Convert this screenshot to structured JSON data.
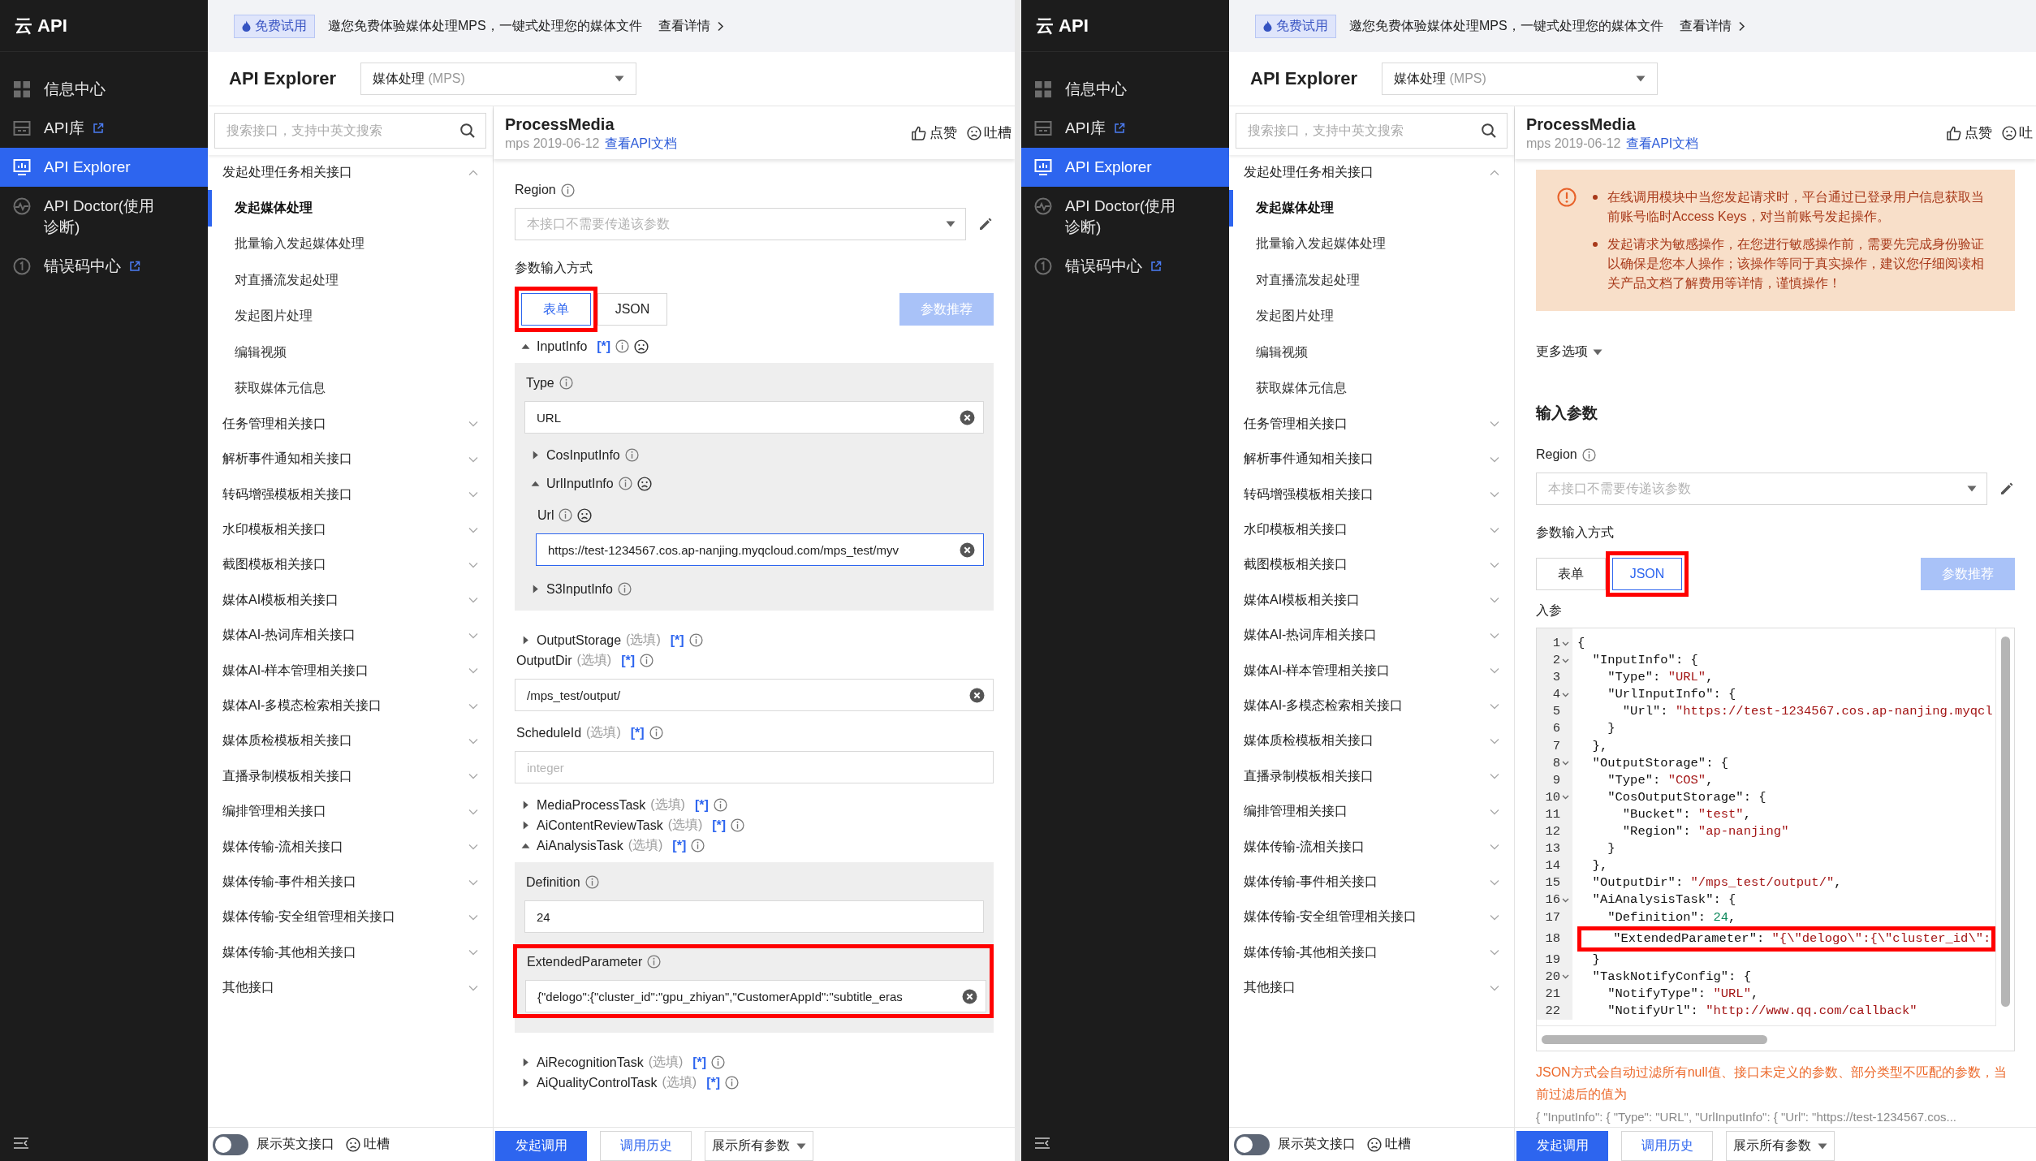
{
  "panes": [
    {
      "nav": {
        "logo": "云 API",
        "items": [
          {
            "label": "信息中心",
            "external": false,
            "selected": false
          },
          {
            "label": "API库",
            "external": true,
            "selected": false
          },
          {
            "label": "API Explorer",
            "external": false,
            "selected": true
          },
          {
            "label": "API Doctor(使用诊断)",
            "external": false,
            "selected": false
          },
          {
            "label": "错误码中心",
            "external": true,
            "selected": false
          }
        ]
      },
      "banner": {
        "tag": "免费试用",
        "text": "邀您免费体验媒体处理MPS，一键式处理您的媒体文件",
        "link": "查看详情"
      },
      "header": {
        "title": "API Explorer",
        "product": "媒体处理",
        "product_code": "(MPS)"
      },
      "search": {
        "placeholder": "搜索接口，支持中英文搜索"
      },
      "api_groups": [
        {
          "label": "发起处理任务相关接口",
          "expanded": true,
          "children": [
            {
              "label": "发起媒体处理",
              "selected": true
            },
            {
              "label": "批量输入发起媒体处理",
              "selected": false
            },
            {
              "label": "对直播流发起处理",
              "selected": false
            },
            {
              "label": "发起图片处理",
              "selected": false
            },
            {
              "label": "编辑视频",
              "selected": false
            },
            {
              "label": "获取媒体元信息",
              "selected": false
            }
          ]
        },
        {
          "label": "任务管理相关接口",
          "expanded": false
        },
        {
          "label": "解析事件通知相关接口",
          "expanded": false
        },
        {
          "label": "转码增强模板相关接口",
          "expanded": false
        },
        {
          "label": "水印模板相关接口",
          "expanded": false
        },
        {
          "label": "截图模板相关接口",
          "expanded": false
        },
        {
          "label": "媒体AI模板相关接口",
          "expanded": false
        },
        {
          "label": "媒体AI-热词库相关接口",
          "expanded": false
        },
        {
          "label": "媒体AI-样本管理相关接口",
          "expanded": false
        },
        {
          "label": "媒体AI-多模态检索相关接口",
          "expanded": false
        },
        {
          "label": "媒体质检模板相关接口",
          "expanded": false
        },
        {
          "label": "直播录制模板相关接口",
          "expanded": false
        },
        {
          "label": "编排管理相关接口",
          "expanded": false
        },
        {
          "label": "媒体传输-流相关接口",
          "expanded": false
        },
        {
          "label": "媒体传输-事件相关接口",
          "expanded": false
        },
        {
          "label": "媒体传输-安全组管理相关接口",
          "expanded": false
        },
        {
          "label": "媒体传输-其他相关接口",
          "expanded": false
        },
        {
          "label": "其他接口",
          "expanded": false
        }
      ],
      "list_footer": {
        "toggle_on": false,
        "toggle_label": "展示英文接口",
        "feedback": "吐槽"
      },
      "api": {
        "name": "ProcessMedia",
        "meta": "mps 2019-06-12",
        "doc_link": "查看API文档",
        "like": "点赞",
        "feedback": "吐槽"
      },
      "blocks": [
        {
          "kind": "select",
          "label": "Region",
          "placeholder": "本接口不需要传递该参数"
        },
        {
          "kind": "mode-switch",
          "label": "参数输入方式",
          "options": [
            {
              "label": "表单",
              "selected": true,
              "highlighted": true
            },
            {
              "label": "JSON",
              "selected": false
            }
          ],
          "recommend": "参数推荐"
        },
        {
          "kind": "params",
          "items": [
            {
              "kind": "group",
              "label": "InputInfo",
              "star": "[*]",
              "info": true,
              "feedback": true,
              "expanded": true,
              "children": [
                {
                  "kind": "field",
                  "label": "Type",
                  "info": true,
                  "value": "URL",
                  "clearable": true,
                  "focused": false
                },
                {
                  "kind": "group",
                  "label": "CosInputInfo",
                  "info": true,
                  "expanded": false
                },
                {
                  "kind": "group",
                  "label": "UrlInputInfo",
                  "info": true,
                  "feedback": true,
                  "expanded": true,
                  "children": [
                    {
                      "kind": "field",
                      "label": "Url",
                      "info": true,
                      "feedback": true,
                      "value": "https://test-1234567.cos.ap-nanjing.myqcloud.com/mps_test/myv",
                      "clearable": true,
                      "focused": true
                    }
                  ]
                },
                {
                  "kind": "group",
                  "label": "S3InputInfo",
                  "info": true,
                  "expanded": false
                }
              ]
            },
            {
              "kind": "group",
              "label": "OutputStorage",
              "optional": "(选填)",
              "star": "[*]",
              "info": true,
              "expanded": false
            },
            {
              "kind": "field",
              "label": "OutputDir",
              "optional": "(选填)",
              "star": "[*]",
              "info": true,
              "value": "/mps_test/output/",
              "clearable": true,
              "focused": false
            },
            {
              "kind": "field",
              "label": "ScheduleId",
              "optional": "(选填)",
              "star": "[*]",
              "info": true,
              "placeholder": "integer",
              "focused": false
            },
            {
              "kind": "group",
              "label": "MediaProcessTask",
              "optional": "(选填)",
              "star": "[*]",
              "info": true,
              "expanded": false
            },
            {
              "kind": "group",
              "label": "AiContentReviewTask",
              "optional": "(选填)",
              "star": "[*]",
              "info": true,
              "expanded": false
            },
            {
              "kind": "group",
              "label": "AiAnalysisTask",
              "optional": "(选填)",
              "star": "[*]",
              "info": true,
              "expanded": true,
              "children": [
                {
                  "kind": "field",
                  "label": "Definition",
                  "info": true,
                  "value": "24",
                  "focused": false
                },
                {
                  "kind": "field",
                  "label": "ExtendedParameter",
                  "info": true,
                  "value": "{\"delogo\":{\"cluster_id\":\"gpu_zhiyan\",\"CustomerAppId\":\"subtitle_eras",
                  "clearable": true,
                  "focused": false,
                  "highlighted": true
                }
              ]
            },
            {
              "kind": "group",
              "label": "AiRecognitionTask",
              "optional": "(选填)",
              "star": "[*]",
              "info": true,
              "expanded": false
            },
            {
              "kind": "group",
              "label": "AiQualityControlTask",
              "optional": "(选填)",
              "star": "[*]",
              "info": true,
              "expanded": false
            }
          ]
        }
      ],
      "actions": {
        "submit": "发起调用",
        "history": "调用历史",
        "show_all": "展示所有参数"
      }
    },
    {
      "nav": {
        "logo": "云 API",
        "items": [
          {
            "label": "信息中心",
            "external": false,
            "selected": false
          },
          {
            "label": "API库",
            "external": true,
            "selected": false
          },
          {
            "label": "API Explorer",
            "external": false,
            "selected": true
          },
          {
            "label": "API Doctor(使用诊断)",
            "external": false,
            "selected": false
          },
          {
            "label": "错误码中心",
            "external": true,
            "selected": false
          }
        ]
      },
      "banner": {
        "tag": "免费试用",
        "text": "邀您免费体验媒体处理MPS，一键式处理您的媒体文件",
        "link": "查看详情"
      },
      "header": {
        "title": "API Explorer",
        "product": "媒体处理",
        "product_code": "(MPS)"
      },
      "search": {
        "placeholder": "搜索接口，支持中英文搜索"
      },
      "api_groups": [
        {
          "label": "发起处理任务相关接口",
          "expanded": true,
          "children": [
            {
              "label": "发起媒体处理",
              "selected": true
            },
            {
              "label": "批量输入发起媒体处理",
              "selected": false
            },
            {
              "label": "对直播流发起处理",
              "selected": false
            },
            {
              "label": "发起图片处理",
              "selected": false
            },
            {
              "label": "编辑视频",
              "selected": false
            },
            {
              "label": "获取媒体元信息",
              "selected": false
            }
          ]
        },
        {
          "label": "任务管理相关接口",
          "expanded": false
        },
        {
          "label": "解析事件通知相关接口",
          "expanded": false
        },
        {
          "label": "转码增强模板相关接口",
          "expanded": false
        },
        {
          "label": "水印模板相关接口",
          "expanded": false
        },
        {
          "label": "截图模板相关接口",
          "expanded": false
        },
        {
          "label": "媒体AI模板相关接口",
          "expanded": false
        },
        {
          "label": "媒体AI-热词库相关接口",
          "expanded": false
        },
        {
          "label": "媒体AI-样本管理相关接口",
          "expanded": false
        },
        {
          "label": "媒体AI-多模态检索相关接口",
          "expanded": false
        },
        {
          "label": "媒体质检模板相关接口",
          "expanded": false
        },
        {
          "label": "直播录制模板相关接口",
          "expanded": false
        },
        {
          "label": "编排管理相关接口",
          "expanded": false
        },
        {
          "label": "媒体传输-流相关接口",
          "expanded": false
        },
        {
          "label": "媒体传输-事件相关接口",
          "expanded": false
        },
        {
          "label": "媒体传输-安全组管理相关接口",
          "expanded": false
        },
        {
          "label": "媒体传输-其他相关接口",
          "expanded": false
        },
        {
          "label": "其他接口",
          "expanded": false
        }
      ],
      "list_footer": {
        "toggle_on": false,
        "toggle_label": "展示英文接口",
        "feedback": "吐槽"
      },
      "api": {
        "name": "ProcessMedia",
        "meta": "mps 2019-06-12",
        "doc_link": "查看API文档",
        "like": "点赞",
        "feedback": "吐"
      },
      "blocks": [
        {
          "kind": "notice",
          "bullets": [
            "在线调用模块中当您发起请求时，平台通过已登录用户信息获取当前账号临时Access Keys，对当前账号发起操作。",
            "发起请求为敏感操作，在您进行敏感操作前，需要先完成身份验证以确保是您本人操作；该操作等同于真实操作，建议您仔细阅读相关产品文档了解费用等详情，谨慎操作！"
          ]
        },
        {
          "kind": "more-options",
          "label": "更多选项"
        },
        {
          "kind": "section-title",
          "label": "输入参数"
        },
        {
          "kind": "select",
          "label": "Region",
          "placeholder": "本接口不需要传递该参数"
        },
        {
          "kind": "mode-switch",
          "label": "参数输入方式",
          "options": [
            {
              "label": "表单",
              "selected": false
            },
            {
              "label": "JSON",
              "selected": true,
              "highlighted": true
            }
          ],
          "recommend": "参数推荐"
        },
        {
          "kind": "label",
          "label": "入参"
        },
        {
          "kind": "code",
          "lines": [
            {
              "number": "1",
              "text": "{",
              "fold": true
            },
            {
              "number": "2",
              "text": "  \"InputInfo\": {",
              "fold": true
            },
            {
              "number": "3",
              "text": "    \"Type\": \"URL\","
            },
            {
              "number": "4",
              "text": "    \"UrlInputInfo\": {",
              "fold": true
            },
            {
              "number": "5",
              "text": "      \"Url\": \"https://test-1234567.cos.ap-nanjing.myqcl"
            },
            {
              "number": "6",
              "text": "    }"
            },
            {
              "number": "7",
              "text": "  },"
            },
            {
              "number": "8",
              "text": "  \"OutputStorage\": {",
              "fold": true
            },
            {
              "number": "9",
              "text": "    \"Type\": \"COS\","
            },
            {
              "number": "10",
              "text": "    \"CosOutputStorage\": {",
              "fold": true
            },
            {
              "number": "11",
              "text": "      \"Bucket\": \"test\","
            },
            {
              "number": "12",
              "text": "      \"Region\": \"ap-nanjing\""
            },
            {
              "number": "13",
              "text": "    }"
            },
            {
              "number": "14",
              "text": "  },"
            },
            {
              "number": "15",
              "text": "  \"OutputDir\": \"/mps_test/output/\","
            },
            {
              "number": "16",
              "text": "  \"AiAnalysisTask\": {",
              "fold": true
            },
            {
              "number": "17",
              "text": "    \"Definition\": 24,"
            },
            {
              "number": "18",
              "text": "    \"ExtendedParameter\": \"{\\\"delogo\\\":{\\\"cluster_id\\\":",
              "highlighted": true
            },
            {
              "number": "19",
              "text": "  }"
            },
            {
              "number": "20",
              "text": "  \"TaskNotifyConfig\": {",
              "fold": true
            },
            {
              "number": "21",
              "text": "    \"NotifyType\": \"URL\","
            },
            {
              "number": "22",
              "text": "    \"NotifyUrl\": \"http://www.qq.com/callback\""
            }
          ]
        },
        {
          "kind": "hint",
          "label": "JSON方式会自动过滤所有null值、接口未定义的参数、部分类型不匹配的参数，当前过滤后的值为"
        },
        {
          "kind": "preview",
          "label": "{ \"InputInfo\": { \"Type\": \"URL\", \"UrlInputInfo\": { \"Url\": \"https://test-1234567.cos..."
        }
      ],
      "actions": {
        "submit": "发起调用",
        "history": "调用历史",
        "show_all": "展示所有参数"
      }
    }
  ]
}
